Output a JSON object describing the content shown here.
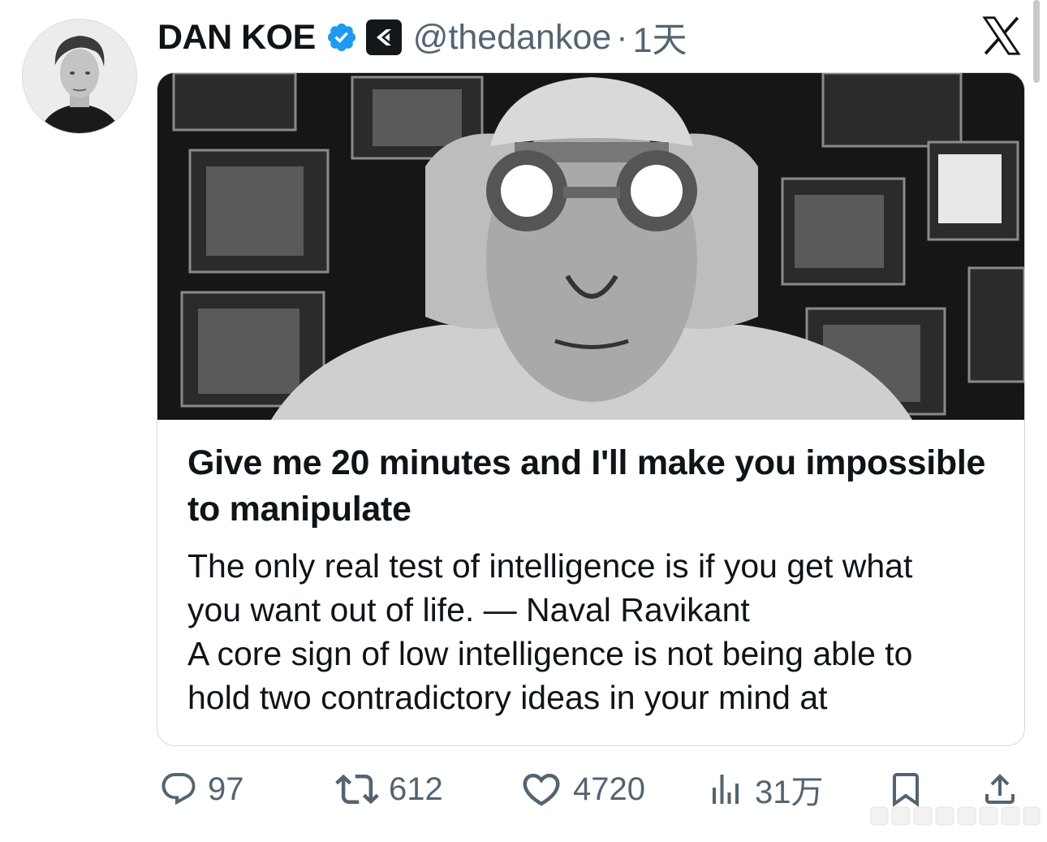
{
  "author": {
    "name": "DAN KOE",
    "handle": "@thedankoe",
    "separator": "·",
    "time": "1天",
    "verified_color": "#1d9bf0"
  },
  "card": {
    "title": "Give me 20 minutes and I'll make you impossible to manipulate",
    "body_lines": [
      "The only real test of intelligence is if you get what",
      "you want out of life. — Naval Ravikant",
      "A core sign of low intelligence is not being able to",
      "hold two contradictory ideas in your mind at"
    ]
  },
  "actions": {
    "replies": "97",
    "reposts": "612",
    "likes": "4720",
    "views": "31万"
  },
  "icons": {
    "reply": "reply-icon",
    "repost": "repost-icon",
    "like": "heart-icon",
    "views": "views-icon",
    "bookmark": "bookmark-icon",
    "share": "share-icon",
    "platform": "x-logo-icon"
  },
  "colors": {
    "text": "#0f1419",
    "secondary": "#536471",
    "border": "#cfd9de"
  }
}
